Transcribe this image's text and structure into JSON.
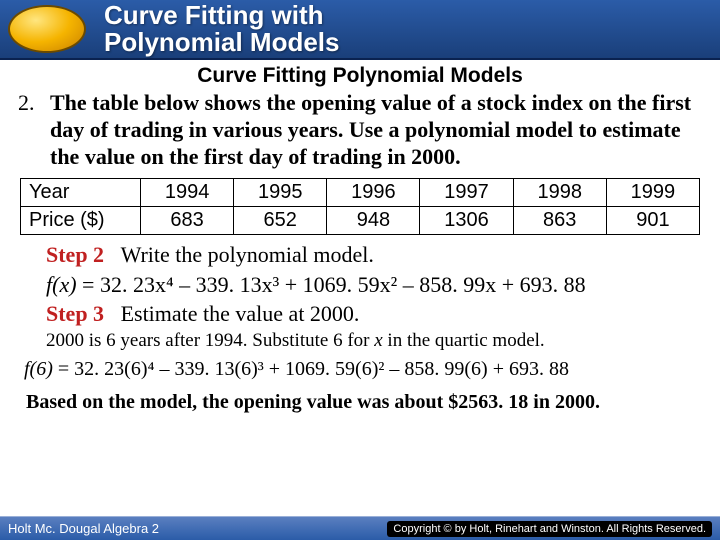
{
  "header": {
    "title_l1": "Curve Fitting with",
    "title_l2": "Polynomial Models"
  },
  "subtitle": "Curve Fitting Polynomial Models",
  "problem": {
    "number": "2.",
    "text": "The table below shows the opening value of a stock index on the first day of trading in various years. Use a polynomial model to estimate the value on the first day of trading in 2000."
  },
  "table": {
    "row1_label": "Year",
    "row2_label": "Price ($)",
    "years": [
      "1994",
      "1995",
      "1996",
      "1997",
      "1998",
      "1999"
    ],
    "prices": [
      "683",
      "652",
      "948",
      "1306",
      "863",
      "901"
    ]
  },
  "step2": {
    "label": "Step 2",
    "text": "Write the polynomial model.",
    "eq_prefix": "f(x)",
    "eq_body": " = 32. 23x⁴ – 339. 13x³ + 1069. 59x² – 858. 99x + 693. 88"
  },
  "step3": {
    "label": "Step 3",
    "text": "Estimate the value at 2000.",
    "note_a": "2000 is 6 years after 1994. Substitute 6 for ",
    "note_var": "x",
    "note_b": " in the quartic model.",
    "eq_prefix": "f(6)",
    "eq_body": " = 32. 23(6)⁴ – 339. 13(6)³ + 1069. 59(6)² – 858. 99(6) + 693. 88"
  },
  "conclusion": "Based on the model, the opening value was about $2563. 18 in 2000.",
  "footer": {
    "left": "Holt Mc. Dougal Algebra 2",
    "right": "Copyright © by Holt, Rinehart and Winston. All Rights Reserved."
  },
  "chart_data": {
    "type": "table",
    "title": "Stock index opening value by year",
    "columns": [
      "Year",
      "Price ($)"
    ],
    "rows": [
      [
        1994,
        683
      ],
      [
        1995,
        652
      ],
      [
        1996,
        948
      ],
      [
        1997,
        1306
      ],
      [
        1998,
        863
      ],
      [
        1999,
        901
      ]
    ]
  }
}
